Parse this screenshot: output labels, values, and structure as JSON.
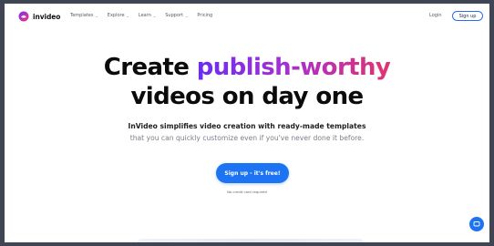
{
  "brand": {
    "name": "invideo",
    "logo_icon": "invideo-logo-icon"
  },
  "nav": {
    "menu": [
      {
        "label": "Templates",
        "dropdown": true
      },
      {
        "label": "Explore",
        "dropdown": true
      },
      {
        "label": "Learn",
        "dropdown": true
      },
      {
        "label": "Support",
        "dropdown": true
      },
      {
        "label": "Pricing",
        "dropdown": false
      }
    ],
    "login_label": "Login",
    "signup_label": "Sign up"
  },
  "hero": {
    "headline_start": "Create ",
    "headline_highlight": "publish-worthy",
    "headline_line2": "videos on day one",
    "subtitle_line1": "InVideo simplifies video creation with ready-made templates",
    "subtitle_line2": "that you can quickly customize even if you've never done it before.",
    "cta_label": "Sign up - it's free!",
    "cta_note": "No credit card required"
  },
  "colors": {
    "accent": "#1c74f3",
    "gradient_start": "#6a2df0",
    "gradient_end": "#e0346f",
    "frame_bg": "#3f4553"
  },
  "chat": {
    "icon": "chat-icon"
  }
}
